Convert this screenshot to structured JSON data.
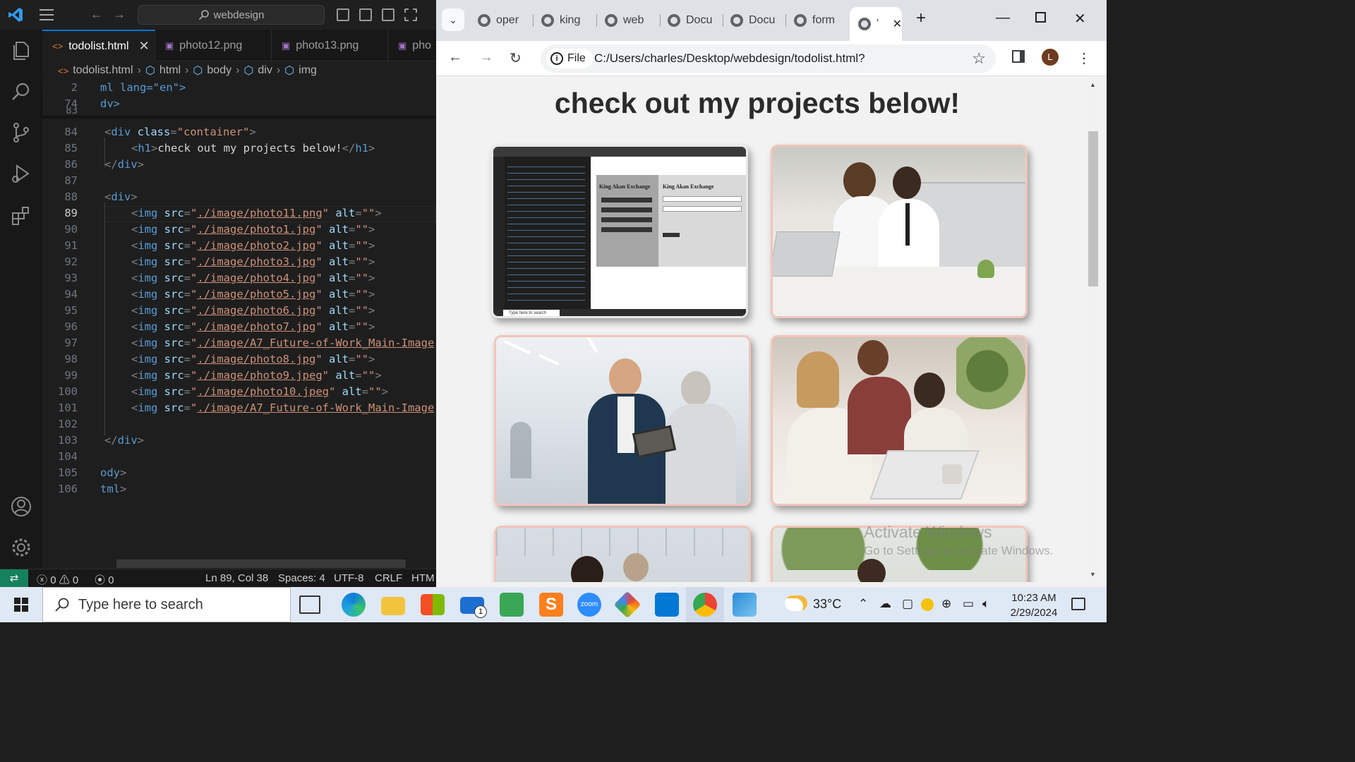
{
  "vscode": {
    "command_center": "webdesign",
    "tabs": [
      {
        "label": "todolist.html",
        "active": true
      },
      {
        "label": "photo12.png",
        "active": false
      },
      {
        "label": "photo13.png",
        "active": false
      },
      {
        "label": "pho",
        "active": false
      }
    ],
    "breadcrumb": [
      "todolist.html",
      "html",
      "body",
      "div",
      "img"
    ],
    "sticky_lines": [
      {
        "num": "2",
        "text": "ml lang=\"en\">"
      },
      {
        "num": "74",
        "text": "dy>"
      },
      {
        "num": "83",
        "text": ""
      }
    ],
    "lines": [
      {
        "num": "84",
        "parts": [
          [
            "punc",
            "<"
          ],
          [
            "tag",
            "div"
          ],
          [
            "attr",
            " class"
          ],
          [
            "punc",
            "="
          ],
          [
            "str",
            "\"container\""
          ],
          [
            "punc",
            ">"
          ]
        ]
      },
      {
        "num": "85",
        "parts": [
          [
            "punc",
            "<"
          ],
          [
            "tag",
            "h1"
          ],
          [
            "punc",
            ">"
          ],
          [
            "txt",
            "check out my projects below!"
          ],
          [
            "punc",
            "</"
          ],
          [
            "tag",
            "h1"
          ],
          [
            "punc",
            ">"
          ]
        ]
      },
      {
        "num": "86",
        "parts": [
          [
            "punc",
            "</"
          ],
          [
            "tag",
            "div"
          ],
          [
            "punc",
            ">"
          ]
        ]
      },
      {
        "num": "87",
        "parts": []
      },
      {
        "num": "88",
        "parts": [
          [
            "punc",
            "<"
          ],
          [
            "tag",
            "div"
          ],
          [
            "punc",
            ">"
          ]
        ]
      },
      {
        "num": "89",
        "parts": [
          [
            "punc",
            "<"
          ],
          [
            "tag",
            "img"
          ],
          [
            "attr",
            " src"
          ],
          [
            "punc",
            "="
          ],
          [
            "str",
            "\""
          ],
          [
            "link",
            "./image/photo11.png"
          ],
          [
            "str",
            "\""
          ],
          [
            "attr",
            " alt"
          ],
          [
            "punc",
            "="
          ],
          [
            "str",
            "\"\""
          ],
          [
            "punc",
            ">"
          ]
        ]
      },
      {
        "num": "90",
        "parts": [
          [
            "punc",
            "<"
          ],
          [
            "tag",
            "img"
          ],
          [
            "attr",
            " src"
          ],
          [
            "punc",
            "="
          ],
          [
            "str",
            "\""
          ],
          [
            "link",
            "./image/photo1.jpg"
          ],
          [
            "str",
            "\""
          ],
          [
            "attr",
            " alt"
          ],
          [
            "punc",
            "="
          ],
          [
            "str",
            "\"\""
          ],
          [
            "punc",
            ">"
          ]
        ]
      },
      {
        "num": "91",
        "parts": [
          [
            "punc",
            "<"
          ],
          [
            "tag",
            "img"
          ],
          [
            "attr",
            " src"
          ],
          [
            "punc",
            "="
          ],
          [
            "str",
            "\""
          ],
          [
            "link",
            "./image/photo2.jpg"
          ],
          [
            "str",
            "\""
          ],
          [
            "attr",
            " alt"
          ],
          [
            "punc",
            "="
          ],
          [
            "str",
            "\"\""
          ],
          [
            "punc",
            ">"
          ]
        ]
      },
      {
        "num": "92",
        "parts": [
          [
            "punc",
            "<"
          ],
          [
            "tag",
            "img"
          ],
          [
            "attr",
            " src"
          ],
          [
            "punc",
            "="
          ],
          [
            "str",
            "\""
          ],
          [
            "link",
            "./image/photo3.jpg"
          ],
          [
            "str",
            "\""
          ],
          [
            "attr",
            " alt"
          ],
          [
            "punc",
            "="
          ],
          [
            "str",
            "\"\""
          ],
          [
            "punc",
            ">"
          ]
        ]
      },
      {
        "num": "93",
        "parts": [
          [
            "punc",
            "<"
          ],
          [
            "tag",
            "img"
          ],
          [
            "attr",
            " src"
          ],
          [
            "punc",
            "="
          ],
          [
            "str",
            "\""
          ],
          [
            "link",
            "./image/photo4.jpg"
          ],
          [
            "str",
            "\""
          ],
          [
            "attr",
            " alt"
          ],
          [
            "punc",
            "="
          ],
          [
            "str",
            "\"\""
          ],
          [
            "punc",
            ">"
          ]
        ]
      },
      {
        "num": "94",
        "parts": [
          [
            "punc",
            "<"
          ],
          [
            "tag",
            "img"
          ],
          [
            "attr",
            " src"
          ],
          [
            "punc",
            "="
          ],
          [
            "str",
            "\""
          ],
          [
            "link",
            "./image/photo5.jpg"
          ],
          [
            "str",
            "\""
          ],
          [
            "attr",
            " alt"
          ],
          [
            "punc",
            "="
          ],
          [
            "str",
            "\"\""
          ],
          [
            "punc",
            ">"
          ]
        ]
      },
      {
        "num": "95",
        "parts": [
          [
            "punc",
            "<"
          ],
          [
            "tag",
            "img"
          ],
          [
            "attr",
            " src"
          ],
          [
            "punc",
            "="
          ],
          [
            "str",
            "\""
          ],
          [
            "link",
            "./image/photo6.jpg"
          ],
          [
            "str",
            "\""
          ],
          [
            "attr",
            " alt"
          ],
          [
            "punc",
            "="
          ],
          [
            "str",
            "\"\""
          ],
          [
            "punc",
            ">"
          ]
        ]
      },
      {
        "num": "96",
        "parts": [
          [
            "punc",
            "<"
          ],
          [
            "tag",
            "img"
          ],
          [
            "attr",
            " src"
          ],
          [
            "punc",
            "="
          ],
          [
            "str",
            "\""
          ],
          [
            "link",
            "./image/photo7.jpg"
          ],
          [
            "str",
            "\""
          ],
          [
            "attr",
            " alt"
          ],
          [
            "punc",
            "="
          ],
          [
            "str",
            "\"\""
          ],
          [
            "punc",
            ">"
          ]
        ]
      },
      {
        "num": "97",
        "parts": [
          [
            "punc",
            "<"
          ],
          [
            "tag",
            "img"
          ],
          [
            "attr",
            " src"
          ],
          [
            "punc",
            "="
          ],
          [
            "str",
            "\""
          ],
          [
            "link",
            "./image/A7_Future-of-Work_Main-Image"
          ]
        ]
      },
      {
        "num": "98",
        "parts": [
          [
            "punc",
            "<"
          ],
          [
            "tag",
            "img"
          ],
          [
            "attr",
            " src"
          ],
          [
            "punc",
            "="
          ],
          [
            "str",
            "\""
          ],
          [
            "link",
            "./image/photo8.jpg"
          ],
          [
            "str",
            "\""
          ],
          [
            "attr",
            " alt"
          ],
          [
            "punc",
            "="
          ],
          [
            "str",
            "\"\""
          ],
          [
            "punc",
            ">"
          ]
        ]
      },
      {
        "num": "99",
        "parts": [
          [
            "punc",
            "<"
          ],
          [
            "tag",
            "img"
          ],
          [
            "attr",
            " src"
          ],
          [
            "punc",
            "="
          ],
          [
            "str",
            "\""
          ],
          [
            "link",
            "./image/photo9.jpeg"
          ],
          [
            "str",
            "\""
          ],
          [
            "attr",
            " alt"
          ],
          [
            "punc",
            "="
          ],
          [
            "str",
            "\"\""
          ],
          [
            "punc",
            ">"
          ]
        ]
      },
      {
        "num": "100",
        "parts": [
          [
            "punc",
            "<"
          ],
          [
            "tag",
            "img"
          ],
          [
            "attr",
            " src"
          ],
          [
            "punc",
            "="
          ],
          [
            "str",
            "\""
          ],
          [
            "link",
            "./image/photo10.jpeg"
          ],
          [
            "str",
            "\""
          ],
          [
            "attr",
            " alt"
          ],
          [
            "punc",
            "="
          ],
          [
            "str",
            "\"\""
          ],
          [
            "punc",
            ">"
          ]
        ]
      },
      {
        "num": "101",
        "parts": [
          [
            "punc",
            "<"
          ],
          [
            "tag",
            "img"
          ],
          [
            "attr",
            " src"
          ],
          [
            "punc",
            "="
          ],
          [
            "str",
            "\""
          ],
          [
            "link",
            "./image/A7_Future-of-Work_Main-Image"
          ]
        ]
      },
      {
        "num": "102",
        "parts": []
      },
      {
        "num": "103",
        "parts": [
          [
            "punc",
            "</"
          ],
          [
            "tag",
            "div"
          ],
          [
            "punc",
            ">"
          ]
        ]
      },
      {
        "num": "104",
        "parts": []
      },
      {
        "num": "105",
        "parts": [
          [
            "punc",
            ""
          ],
          [
            "tag",
            "ody"
          ],
          [
            "punc",
            ">"
          ]
        ]
      },
      {
        "num": "106",
        "parts": [
          [
            "punc",
            ""
          ],
          [
            "tag",
            "tml"
          ],
          [
            "punc",
            ">"
          ]
        ]
      }
    ],
    "status": {
      "errors": "0",
      "warnings": "0",
      "ports": "0",
      "position": "Ln 89, Col 38",
      "spaces": "Spaces: 4",
      "encoding": "UTF-8",
      "eol": "CRLF",
      "language": "HTM"
    }
  },
  "chrome": {
    "tabs": [
      "oper",
      "king",
      "web",
      "Docu",
      "Docu",
      "form"
    ],
    "active_tab_label": "'",
    "address_chip": "File",
    "url": "C:/Users/charles/Desktop/webdesign/todolist.html?",
    "avatar_letter": "L",
    "page": {
      "heading": "check out my projects below!",
      "mini_screenshot": {
        "left_title": "King Akan Exchange",
        "right_title": "King Akan Exchange",
        "taskbar_search": "Type here to search"
      },
      "watermark_title": "Activate Windows",
      "watermark_subtitle": "Go to Settings to activate Windows."
    }
  },
  "taskbar": {
    "search_placeholder": "Type here to search",
    "mail_badge": "1",
    "zoom_label": "zoom",
    "weather": "33°C",
    "time": "10:23 AM",
    "date": "2/29/2024"
  }
}
